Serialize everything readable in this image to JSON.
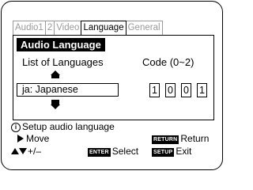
{
  "tabs": [
    {
      "label": "Audio1",
      "active": false
    },
    {
      "label": "2",
      "active": false
    },
    {
      "label": "Video",
      "active": false
    },
    {
      "label": "Language",
      "active": true
    },
    {
      "label": "General",
      "active": false
    }
  ],
  "panel": {
    "title": "Audio Language",
    "list_label": "List of Languages",
    "code_label": "Code (0~2)",
    "selected_language": "ja: Japanese",
    "code_digits": [
      "1",
      "0",
      "0",
      "1"
    ]
  },
  "help": {
    "text": "Setup audio language",
    "move_label": "Move",
    "adjust_label": "+/–",
    "enter_key": "ENTER",
    "enter_label": "Select",
    "return_key": "RETURN",
    "return_label": "Return",
    "setup_key": "SETUP",
    "setup_label": "Exit"
  }
}
